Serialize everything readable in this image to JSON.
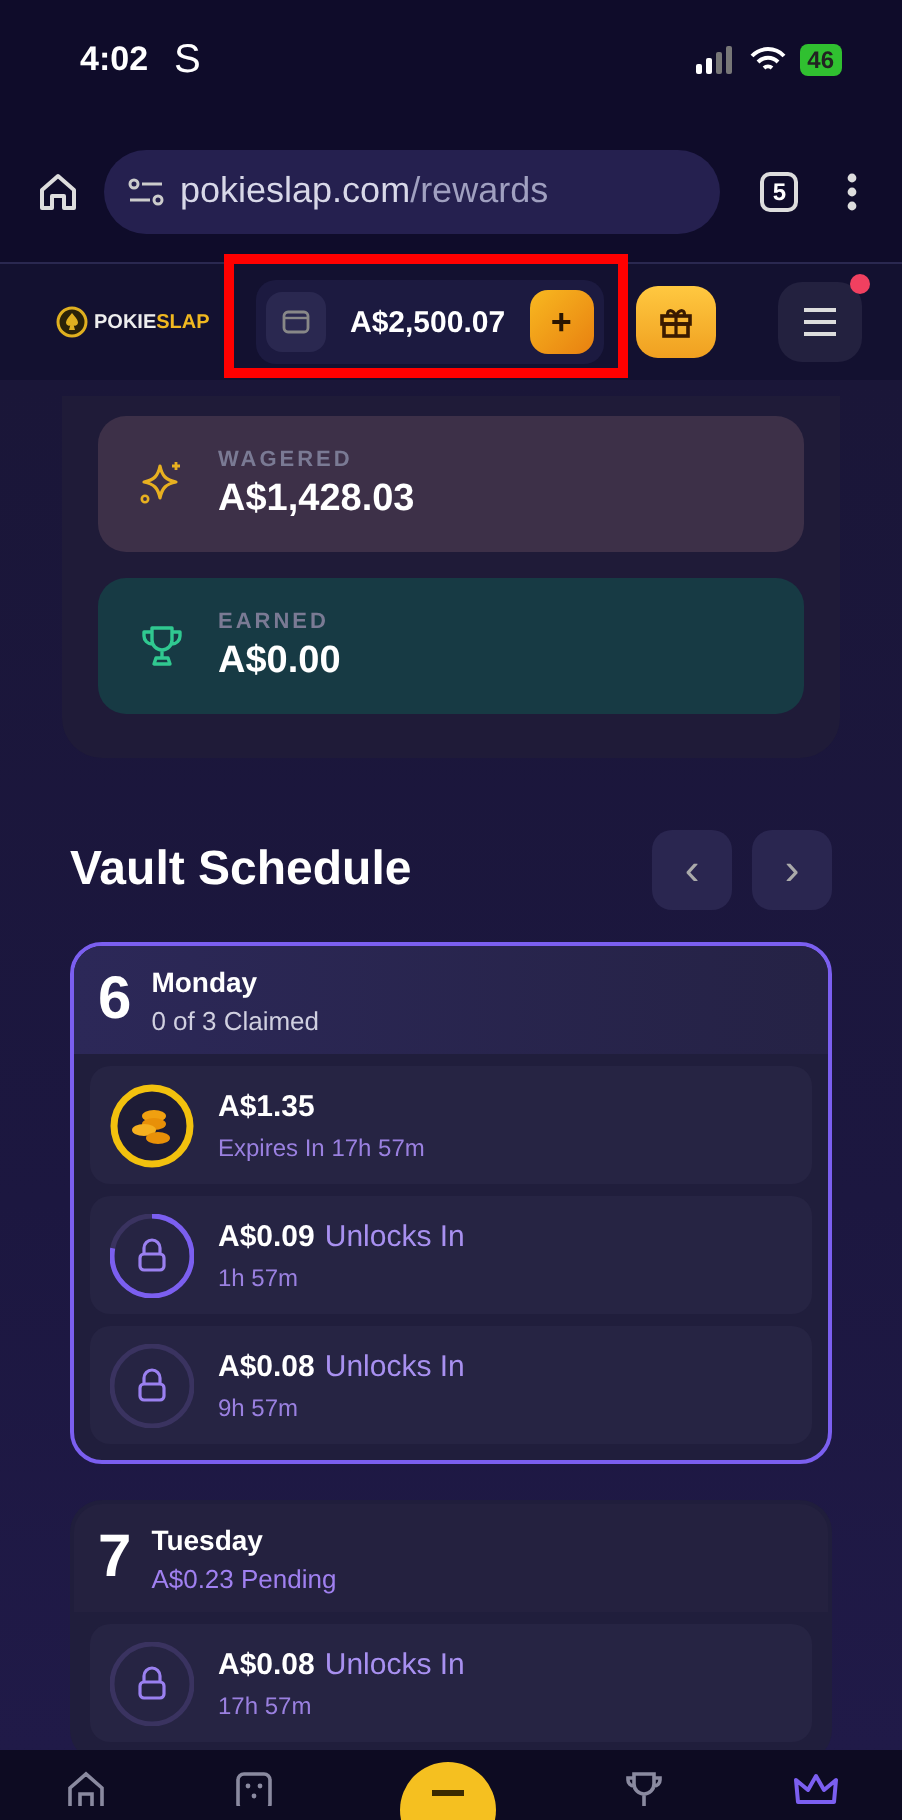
{
  "status_bar": {
    "time": "4:02",
    "app_letter": "S",
    "battery": "46"
  },
  "browser": {
    "url_host": "pokieslap.com",
    "url_path": "/rewards",
    "tab_count": "5"
  },
  "header": {
    "logo_text_1": "POKIE",
    "logo_text_2": "SLAP",
    "balance": "A$2,500.07",
    "add_label": "+",
    "notification": true
  },
  "stats": [
    {
      "kind": "wagered",
      "label": "WAGERED",
      "value": "A$1,428.03"
    },
    {
      "kind": "earned",
      "label": "EARNED",
      "value": "A$0.00"
    }
  ],
  "schedule": {
    "title": "Vault Schedule",
    "prev": "‹",
    "next": "›"
  },
  "days": [
    {
      "number": "6",
      "name": "Monday",
      "subtitle": "0 of 3 Claimed",
      "selected": true,
      "items": [
        {
          "kind": "coin",
          "amount": "A$1.35",
          "note": "Expires In 17h 57m"
        },
        {
          "kind": "unlocking",
          "amount": "A$0.09",
          "label": "Unlocks In",
          "note": "1h 57m"
        },
        {
          "kind": "locked",
          "amount": "A$0.08",
          "label": "Unlocks In",
          "note": "9h 57m"
        }
      ]
    },
    {
      "number": "7",
      "name": "Tuesday",
      "subtitle": "A$0.23 Pending",
      "selected": false,
      "items": [
        {
          "kind": "locked",
          "amount": "A$0.08",
          "label": "Unlocks In",
          "note": "17h 57m"
        }
      ]
    }
  ],
  "bottom_nav": [
    {
      "kind": "home",
      "selected": false
    },
    {
      "kind": "dice",
      "selected": false
    },
    {
      "kind": "center",
      "selected": false
    },
    {
      "kind": "trophy",
      "selected": false
    },
    {
      "kind": "crown",
      "selected": true
    }
  ]
}
